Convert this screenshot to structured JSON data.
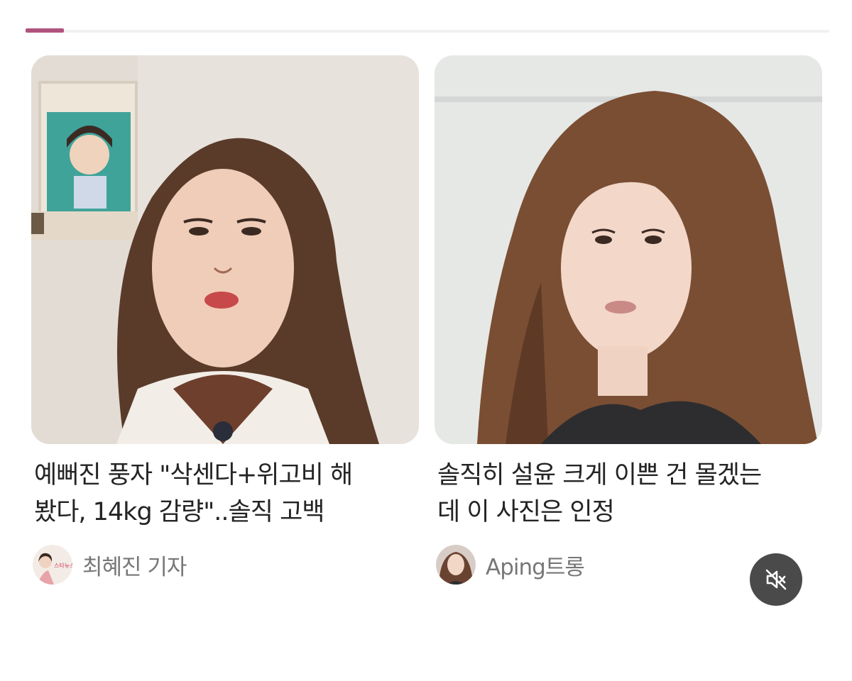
{
  "cards": [
    {
      "headline_line1": "예뻐진 풍자 \"삭센다+위고비 해",
      "headline_line2": "봤다, 14kg 감량\"..솔직 고백",
      "author": "최혜진 기자",
      "avatar_text": "스타뉴스"
    },
    {
      "headline_line1": "솔직히 설윤 크게 이쁜 건 몰겠는",
      "headline_line2": "데 이 사진은 인정",
      "author": "Aping트롱"
    }
  ],
  "controls": {
    "mute_icon": "speaker-muted-icon"
  },
  "colors": {
    "accent": "#b0537c",
    "mute_button": "#4a4a4a"
  }
}
